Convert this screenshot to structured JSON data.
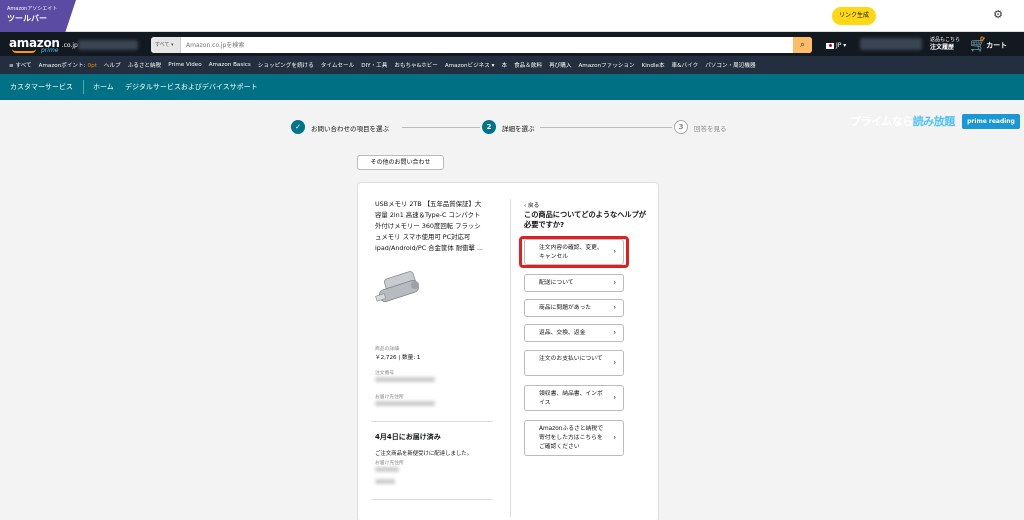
{
  "toolbar": {
    "badge_small": "Amazonアソシエイト",
    "badge_title": "ツールバー",
    "link_button": "リンク生成"
  },
  "header": {
    "logo_word": "amazon",
    "logo_tld": ".co.jp",
    "logo_prime": "prime",
    "search_category": "すべて ▾",
    "search_placeholder": "Amazon.co.jpを検索",
    "locale": "JP",
    "returns_line1": "返品もこちら",
    "returns_line2": "注文履歴",
    "cart_count": "0",
    "cart_label": "カート"
  },
  "nav": {
    "items": [
      "≡ すべて",
      "Amazonポイント:",
      "ヘルプ",
      "ふるさと納税",
      "Prime Video",
      "Amazon Basics",
      "ショッピングを続ける",
      "タイムセール",
      "DIY・工具",
      "おもちゃ&ホビー",
      "Amazonビジネス ▾",
      "本",
      "食品＆飲料",
      "再び購入",
      "Amazonファッション",
      "Kindle本",
      "車&バイク",
      "パソコン・周辺機器"
    ],
    "points_value": "0pt",
    "prime_banner_a": "プライムなら",
    "prime_banner_b": "読み放題",
    "prime_reading": "prime reading"
  },
  "cs_bar": {
    "title": "カスタマーサービス",
    "home": "ホーム",
    "digital": "デジタルサービスおよびデバイスサポート"
  },
  "steps": [
    {
      "num": "✓",
      "label": "お問い合わせの項目を選ぶ"
    },
    {
      "num": "2",
      "label": "詳細を選ぶ"
    },
    {
      "num": "3",
      "label": "回答を見る"
    }
  ],
  "other_inquiry": "その他のお問い合わせ",
  "product": {
    "title_lines": [
      "USBメモリ 2TB 【五年品質保証】大",
      "容量 2in1 高速＆Type-C コンパクト",
      "外付けメモリー 360度回転 フラッシ",
      "ュメモリ スマホ使用可 PC対応可",
      "ipad/Android/PC 合金筐体 耐衝擊 ..."
    ],
    "detail_label": "商品の詳細",
    "detail_value": "￥2,726 | 数量: 1",
    "order_label": "注文番号",
    "address_label": "お届け先住所",
    "delivered": "4月4日にお届け済み",
    "delivered_note": "ご注文商品を新便受けに配達しました。",
    "recipient_label": "お届け先住所"
  },
  "help": {
    "back": "‹ 戻る",
    "question": "この商品についてどのようなヘルプが必要ですか?",
    "options": [
      "注文内容の確認、変更、キャンセル",
      "配送について",
      "商品に問題があった",
      "返品、交換、返金",
      "注文のお支払いについて",
      "領収書、納品書、インボイス",
      "Amazonふるさと納税で寄付をした方はこちらをご確認ください"
    ]
  },
  "colors": {
    "teal": "#007185",
    "highlight": "#e02020",
    "nav_dark": "#131921"
  }
}
